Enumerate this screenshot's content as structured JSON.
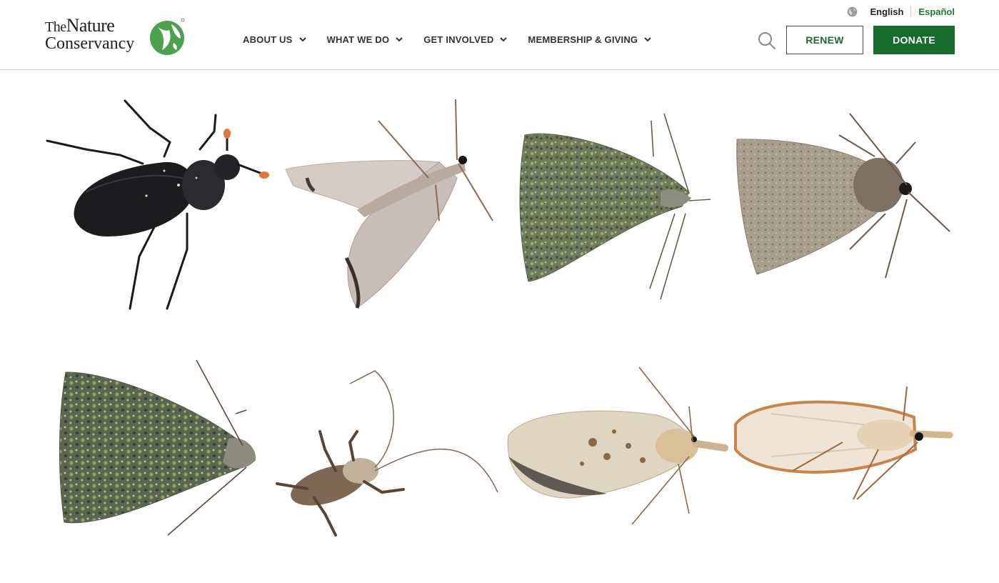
{
  "header": {
    "logo": {
      "line1_the": "The",
      "line1_rest": "Nature",
      "line2": "Conservancy"
    },
    "language": {
      "current": "English",
      "alternate": "Español",
      "icon": "globe-icon"
    },
    "nav": [
      {
        "label": "ABOUT US",
        "icon": "chevron-down-icon"
      },
      {
        "label": "WHAT WE DO",
        "icon": "chevron-down-icon"
      },
      {
        "label": "GET INVOLVED",
        "icon": "chevron-down-icon"
      },
      {
        "label": "MEMBERSHIP & GIVING",
        "icon": "chevron-down-icon"
      }
    ],
    "search_icon": "search-icon",
    "renew_label": "RENEW",
    "donate_label": "DONATE"
  },
  "colors": {
    "brand_green": "#176b2c",
    "link_green": "#1c7a3a",
    "text": "#333333"
  },
  "gallery": {
    "items": [
      {
        "name": "burying-beetle"
      },
      {
        "name": "pale-moth-underside"
      },
      {
        "name": "green-mottled-moth"
      },
      {
        "name": "fuzzy-brown-moth"
      },
      {
        "name": "green-lichen-moth"
      },
      {
        "name": "camel-cricket"
      },
      {
        "name": "tan-leafroller-moth"
      },
      {
        "name": "orange-moth-underside"
      }
    ]
  }
}
